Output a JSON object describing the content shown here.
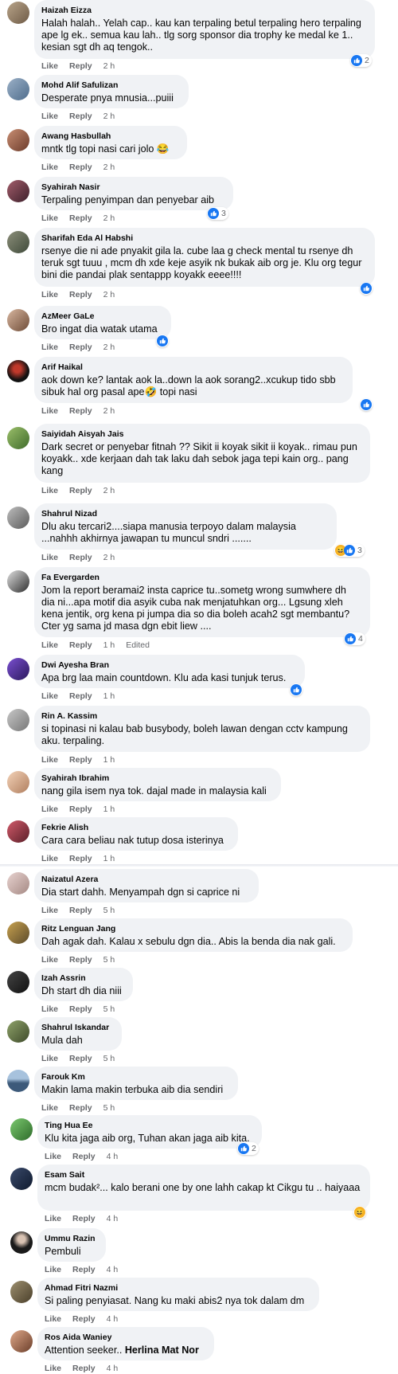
{
  "actions": {
    "like": "Like",
    "reply": "Reply",
    "edited": "Edited"
  },
  "colors": {
    "bubble": "#f0f2f5",
    "like_blue": "#1877f2",
    "meta_gray": "#65676b"
  },
  "comments": [
    {
      "author": "Haizah Eizza",
      "text": "Halah halah.. Yelah cap.. kau kan terpaling betul terpaling hero terpaling ape lg ek.. semua kau lah.. tlg sorg sponsor dia trophy ke medal ke 1.. kesian sgt dh aq tengok..",
      "time": "2 h",
      "reactions": "2"
    },
    {
      "author": "Mohd Alif Safulizan",
      "text": "Desperate pnya mnusia...puiii",
      "time": "2 h"
    },
    {
      "author": "Awang Hasbullah",
      "text": "mntk tlg topi nasi cari jolo 😂",
      "time": "2 h"
    },
    {
      "author": "Syahirah Nasir",
      "text": "Terpaling penyimpan dan penyebar aib",
      "time": "2 h",
      "reactions": "3"
    },
    {
      "author": "Sharifah Eda Al Habshi",
      "text": "rsenye die ni ade pnyakit gila la. cube laa g check mental tu rsenye dh teruk sgt tuuu , mcm dh xde keje asyik nk bukak aib org je. Klu org tegur bini die pandai plak sentappp koyakk eeee!!!!",
      "time": "2 h"
    },
    {
      "author": "AzMeer GaLe",
      "text": "Bro ingat dia watak utama",
      "time": "2 h"
    },
    {
      "author": "Arif Haikal",
      "text": "aok down ke? lantak aok la..down la aok sorang2..xcukup tido sbb sibuk hal org pasal ape🤣 topi nasi",
      "time": "2 h"
    },
    {
      "author": "Saiyidah Aisyah Jais",
      "text": "Dark secret or penyebar fitnah ?? Sikit ii koyak sikit ii koyak.. rimau pun koyakk.. xde kerjaan dah tak laku dah sebok jaga tepi kain org.. pang kang",
      "time": "2 h"
    },
    {
      "author": "Shahrul Nizad",
      "text": "Dlu aku tercari2....siapa manusia terpoyo dalam malaysia ...nahhh akhirnya jawapan tu muncul sndri .......",
      "time": "2 h",
      "reactions": "3"
    },
    {
      "author": "Fa Evergarden",
      "text": "Jom la report beramai2 insta caprice tu..sometg wrong sumwhere dh dia ni...apa motif dia asyik cuba nak menjatuhkan org... Lgsung xleh kena jentik, org kena pi jumpa dia so dia boleh acah2 sgt membantu? Cter yg sama jd masa dgn ebit liew ....",
      "time": "1 h",
      "reactions": "4"
    },
    {
      "author": "Dwi Ayesha Bran",
      "text": "Apa brg laa main countdown. Klu ada kasi tunjuk terus.",
      "time": "1 h"
    },
    {
      "author": "Rin A. Kassim",
      "text": "si topinasi ni kalau bab busybody, boleh lawan dengan cctv kampung aku. terpaling.",
      "time": "1 h"
    },
    {
      "author": "Syahirah Ibrahim",
      "text": "nang gila isem nya tok. dajal made in malaysia kali",
      "time": "1 h"
    },
    {
      "author": "Fekrie Alish",
      "text": "Cara cara beliau nak tutup dosa isterinya",
      "time": "1 h"
    },
    {
      "author": "Naizatul Azera",
      "text": "Dia start dahh. Menyampah dgn si caprice ni",
      "time": "5 h"
    },
    {
      "author": "Ritz Lenguan Jang",
      "text": "Dah agak dah. Kalau x sebulu dgn dia.. Abis la benda dia nak gali.",
      "time": "5 h"
    },
    {
      "author": "Izah Assrin",
      "text": "Dh start dh dia niii",
      "time": "5 h"
    },
    {
      "author": "Shahrul Iskandar",
      "text": "Mula dah",
      "time": "5 h"
    },
    {
      "author": "Farouk Km",
      "text": "Makin lama makin terbuka aib dia sendiri",
      "time": "5 h"
    },
    {
      "author": "Ting Hua Ee",
      "text": "Klu kita jaga aib org, Tuhan akan jaga aib kita.",
      "time": "4 h",
      "reactions": "2"
    },
    {
      "author": "Esam Sait",
      "text": "mcm budak²... kalo berani one by one lahh cakap kt Cikgu tu .. haiyaaa",
      "time": "4 h"
    },
    {
      "author": "Ummu Razin",
      "text": "Pembuli",
      "time": "4 h"
    },
    {
      "author": "Ahmad Fitri Nazmi",
      "text": "Si paling penyiasat. Nang ku maki abis2 nya tok dalam dm",
      "time": "4 h"
    },
    {
      "author": "Ros Aida Waniey",
      "text": "Attention seeker..",
      "mention": "Herlina Mat Nor",
      "time": "4 h"
    }
  ]
}
